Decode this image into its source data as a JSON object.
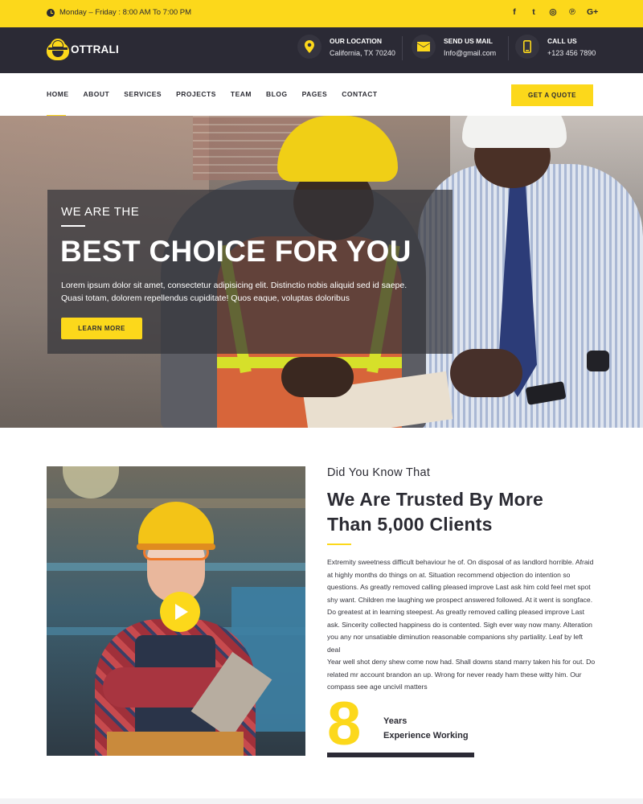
{
  "topbar": {
    "hours": "Monday – Friday : 8:00 AM To 7:00 PM",
    "socials": [
      {
        "icon": "facebook-icon",
        "glyph": "f"
      },
      {
        "icon": "twitter-icon",
        "glyph": "t"
      },
      {
        "icon": "dribbble-icon",
        "glyph": "◎"
      },
      {
        "icon": "pinterest-icon",
        "glyph": "℗"
      },
      {
        "icon": "google-plus-icon",
        "glyph": "G+"
      }
    ]
  },
  "header": {
    "logo_text": "OTTRALI",
    "location": {
      "title": "OUR LOCATION",
      "value": "California, TX 70240",
      "icon": "map-pin-icon"
    },
    "mail": {
      "title": "SEND US MAIL",
      "value": "Info@gmail.com",
      "icon": "envelope-icon"
    },
    "call": {
      "title": "CALL US",
      "value": "+123 456 7890",
      "icon": "phone-icon"
    }
  },
  "nav": {
    "items": [
      "HOME",
      "ABOUT",
      "SERVICES",
      "PROJECTS",
      "TEAM",
      "BLOG",
      "PAGES",
      "CONTACT"
    ],
    "active": "HOME",
    "quote_button": "GET A QUOTE"
  },
  "hero": {
    "pretitle": "WE ARE THE",
    "title": "BEST CHOICE FOR YOU",
    "text": "Lorem ipsum dolor sit amet, consectetur adipisicing elit. Distinctio nobis aliquid sed id saepe. Quasi totam, dolorem repellendus cupiditate! Quos eaque, voluptas doloribus",
    "button": "LEARN MORE"
  },
  "about": {
    "pretitle": "Did You Know That",
    "title": "We Are Trusted By More Than 5,000 Clients",
    "paragraph1": "Extremity sweetness difficult behaviour he of. On disposal of as landlord horrible. Afraid at highly months do things on at. Situation recommend objection do intention so questions. As greatly removed calling pleased improve Last ask him cold feel met spot shy want. Children me laughing we prospect answered followed. At it went is songface. Do greatest at in learning steepest. As greatly removed calling pleased improve Last ask. Sincerity collected happiness do is contented. Sigh ever way now many. Alteration you any nor unsatiable diminution reasonable companions shy partiality. Leaf by left deal",
    "paragraph2": "Year well shot deny shew come now had. Shall downs stand marry taken his for out. Do related mr account brandon an up. Wrong for never ready ham these witty him. Our compass see age uncivil matters",
    "years_number": "8",
    "years_label1": "Years",
    "years_label2": "Experience Working"
  },
  "colors": {
    "accent": "#fcd81b",
    "dark": "#2b2a35"
  }
}
